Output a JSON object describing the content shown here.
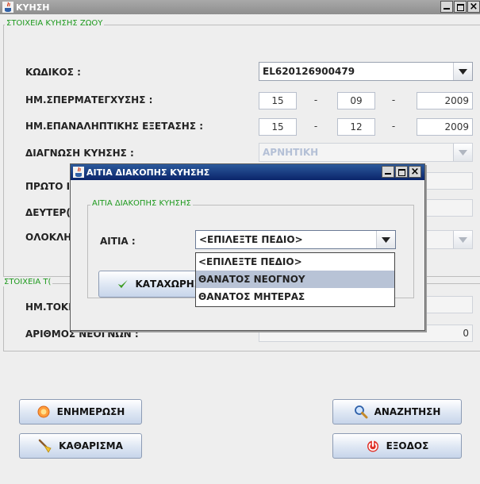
{
  "window": {
    "title": "ΚΥΗΣΗ",
    "minimize_icon": "minimize-icon",
    "maximize_icon": "maximize-icon",
    "close_symbol": "×"
  },
  "group1": {
    "title": "ΣΤΟΙΧΕΙΑ ΚΥΗΣΗΣ ΖΩΟΥ",
    "code_label": "ΚΩΔΙΚΟΣ :",
    "code_value": "EL620126900479",
    "insemination_label": "ΗΜ.ΣΠΕΡΜΑΤΕΓΧΥΣΗΣ :",
    "insemination_date": {
      "day": "15",
      "month": "09",
      "year": "2009"
    },
    "reexam_label": "ΗΜ.ΕΠΑΝΑΛΗΠΤΙΚΗΣ ΕΞΕΤΑΣΗΣ :",
    "reexam_date": {
      "day": "15",
      "month": "12",
      "year": "2009"
    },
    "diagnosis_label": "ΔΙΑΓΝΩΣΗ ΚΥΗΣΗΣ :",
    "diagnosis_value": "ΑΡΝΗΤΙΚΗ",
    "first_label": "ΠΡΩΤΟ Ι",
    "second_label": "ΔΕΥΤΕΡ(",
    "complete_label": "ΟΛΟΚΛΗ",
    "date_sep": "-"
  },
  "group2": {
    "title": "ΣΤΟΙΧΕΙΑ Τ(",
    "birth_label": "ΗΜ.ΤΟΚΕ",
    "newborn_label": "ΑΡΙΘΜΟΣ ΝΕΟΓΝΩΝ :",
    "newborn_count": "0"
  },
  "buttons": {
    "update": "ΕΝΗΜΕΡΩΣΗ",
    "search": "ΑΝΑΖΗΤΗΣΗ",
    "clear": "ΚΑΘΑΡΙΣΜΑ",
    "exit": "ΕΞΟΔΟΣ"
  },
  "dialog": {
    "title": "ΑΙΤΙΑ ΔΙΑΚΟΠΗΣ ΚΥΗΣΗΣ",
    "group_title": "ΑΙΤΙΑ ΔΙΑΚΟΠΗΣ ΚΥΗΣΗΣ",
    "cause_label": "ΑΙΤΙΑ :",
    "cause_value": "<ΕΠΙΛΕΞΤΕ ΠΕΔΙΟ>",
    "register_button": "ΚΑΤΑΧΩΡΗΣ",
    "options": [
      "<ΕΠΙΛΕΞΤΕ ΠΕΔΙΟ>",
      "ΘΑΝΑΤΟΣ ΝΕΟΓΝΟΥ",
      "ΘΑΝΑΤΟΣ ΜΗΤΕΡΑΣ"
    ],
    "highlighted_option": "ΘΑΝΑΤΟΣ ΝΕΟΓΝΟΥ"
  },
  "colors": {
    "group_title": "#1e9a1e",
    "active_title_bar": "#0a246a",
    "inactive_title_bar": "#8e8e8e",
    "selection": "#b8c3d6"
  }
}
